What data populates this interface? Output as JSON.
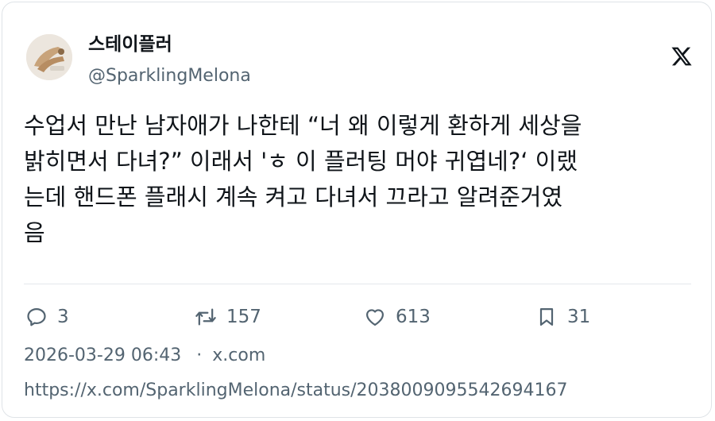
{
  "author": {
    "display_name": "스테이플러",
    "handle": "@SparklingMelona",
    "avatar_icon": "avatar-image"
  },
  "brand": {
    "logo_icon": "x-logo-icon"
  },
  "tweet": {
    "lines": [
      "수업서 만난 남자애가 나한테 “너 왜 이렇게 환하게 세상을",
      "밝히면서 다녀?” 이래서 'ㅎ 이 플러팅 머야 귀엽네?‘ 이랬",
      "는데 핸드폰 플래시 계속 켜고 다녀서 끄라고 알려준거였",
      "음"
    ]
  },
  "actions": {
    "replies": {
      "icon": "reply-icon",
      "count": "3"
    },
    "retweets": {
      "icon": "retweet-icon",
      "count": "157"
    },
    "likes": {
      "icon": "heart-icon",
      "count": "613"
    },
    "bookmarks": {
      "icon": "bookmark-icon",
      "count": "31"
    }
  },
  "meta": {
    "timestamp": "2026-03-29 06:43",
    "separator": "·",
    "source": "x.com"
  },
  "url": "https://x.com/SparklingMelona/status/2038009095542694167",
  "colors": {
    "text": "#0f1419",
    "secondary": "#536471",
    "border": "#dfe3e7"
  }
}
